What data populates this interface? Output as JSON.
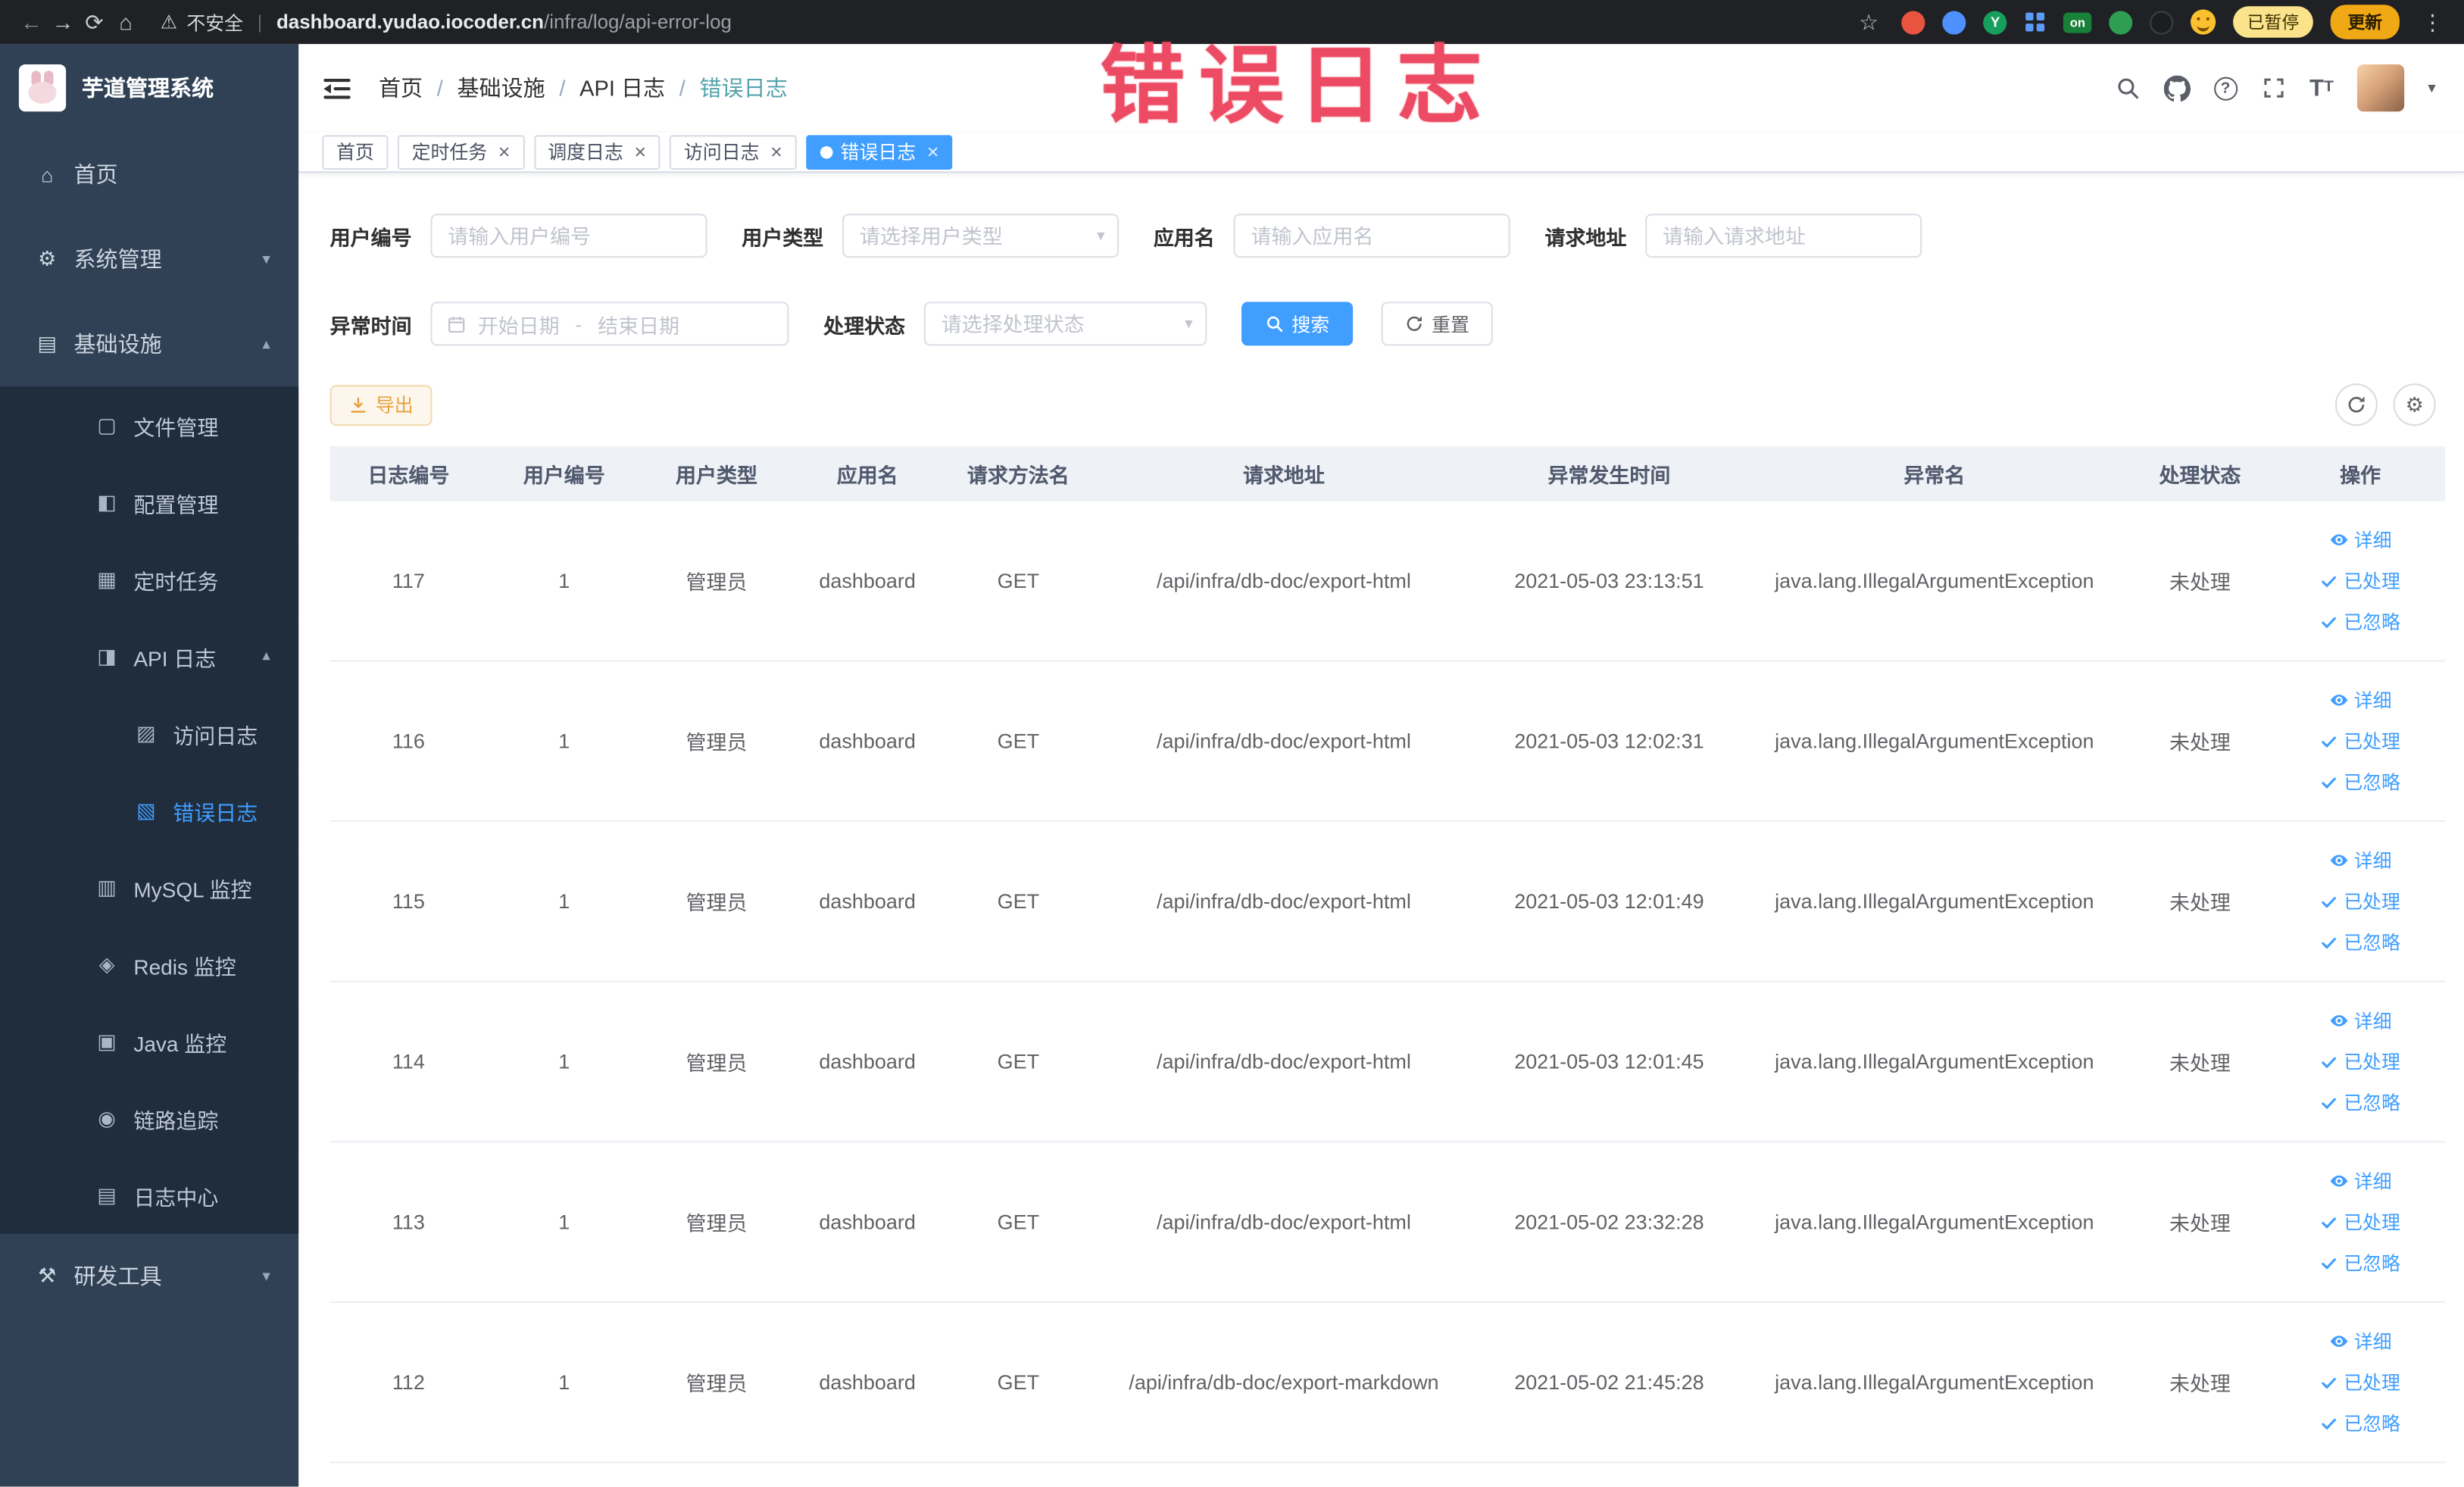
{
  "browser": {
    "security_label": "不安全",
    "url_host": "dashboard.yudao.iocoder.cn",
    "url_path": "/infra/log/api-error-log",
    "extension_badge_on": "on",
    "extension_letter": "Y",
    "paused_badge": "已暂停",
    "update_button": "更新"
  },
  "annotation": {
    "text": "错误日志",
    "color": "#ec4b63"
  },
  "sidebar": {
    "title": "芋道管理系统",
    "items": [
      {
        "key": "home",
        "label": "首页",
        "icon": "home",
        "level": 1
      },
      {
        "key": "system-mgmt",
        "label": "系统管理",
        "icon": "system",
        "level": 1,
        "arrow": "down"
      },
      {
        "key": "infrastructure",
        "label": "基础设施",
        "icon": "infra",
        "level": 1,
        "arrow": "up"
      },
      {
        "key": "file-mgmt",
        "label": "文件管理",
        "icon": "file",
        "level": 2,
        "sub": true
      },
      {
        "key": "config-mgmt",
        "label": "配置管理",
        "icon": "config",
        "level": 2,
        "sub": true
      },
      {
        "key": "scheduled-tasks",
        "label": "定时任务",
        "icon": "task",
        "level": 2,
        "sub": true
      },
      {
        "key": "api-log",
        "label": "API 日志",
        "icon": "apilog",
        "level": 2,
        "sub": true,
        "arrow": "up"
      },
      {
        "key": "access-log",
        "label": "访问日志",
        "icon": "access",
        "level": 3,
        "sub": true
      },
      {
        "key": "error-log",
        "label": "错误日志",
        "icon": "error",
        "level": 3,
        "sub": true,
        "active": true
      },
      {
        "key": "mysql-monitor",
        "label": "MySQL 监控",
        "icon": "mysql",
        "level": 2,
        "sub": true
      },
      {
        "key": "redis-monitor",
        "label": "Redis 监控",
        "icon": "redis",
        "level": 2,
        "sub": true
      },
      {
        "key": "java-monitor",
        "label": "Java 监控",
        "icon": "java",
        "level": 2,
        "sub": true
      },
      {
        "key": "trace",
        "label": "链路追踪",
        "icon": "trace",
        "level": 2,
        "sub": true
      },
      {
        "key": "log-center",
        "label": "日志中心",
        "icon": "logcenter",
        "level": 2,
        "sub": true
      },
      {
        "key": "dev-tools",
        "label": "研发工具",
        "icon": "tools",
        "level": 1,
        "arrow": "down"
      }
    ]
  },
  "breadcrumb": [
    "首页",
    "基础设施",
    "API 日志",
    "错误日志"
  ],
  "tabs": [
    {
      "label": "首页",
      "closable": false,
      "active": false
    },
    {
      "label": "定时任务",
      "closable": true,
      "active": false
    },
    {
      "label": "调度日志",
      "closable": true,
      "active": false
    },
    {
      "label": "访问日志",
      "closable": true,
      "active": false
    },
    {
      "label": "错误日志",
      "closable": true,
      "active": true
    }
  ],
  "filters": {
    "fields_row1": [
      {
        "label": "用户编号",
        "type": "input",
        "placeholder": "请输入用户编号"
      },
      {
        "label": "用户类型",
        "type": "select",
        "placeholder": "请选择用户类型"
      },
      {
        "label": "应用名",
        "type": "input",
        "placeholder": "请输入应用名"
      },
      {
        "label": "请求地址",
        "type": "input",
        "placeholder": "请输入请求地址"
      }
    ],
    "date_field": {
      "label": "异常时间",
      "start_placeholder": "开始日期",
      "separator": "-",
      "end_placeholder": "结束日期"
    },
    "status_field": {
      "label": "处理状态",
      "placeholder": "请选择处理状态"
    },
    "search_button": "搜索",
    "reset_button": "重置"
  },
  "toolbar": {
    "export_button": "导出"
  },
  "table": {
    "columns": [
      "日志编号",
      "用户编号",
      "用户类型",
      "应用名",
      "请求方法名",
      "请求地址",
      "异常发生时间",
      "异常名",
      "处理状态",
      "操作"
    ],
    "action_labels": [
      "详细",
      "已处理",
      "已忽略"
    ],
    "rows": [
      {
        "log_id": "117",
        "user_id": "1",
        "user_type": "管理员",
        "app": "dashboard",
        "method": "GET",
        "url": "/api/infra/db-doc/export-html",
        "time": "2021-05-03 23:13:51",
        "exception": "java.lang.IllegalArgumentException",
        "status": "未处理"
      },
      {
        "log_id": "116",
        "user_id": "1",
        "user_type": "管理员",
        "app": "dashboard",
        "method": "GET",
        "url": "/api/infra/db-doc/export-html",
        "time": "2021-05-03 12:02:31",
        "exception": "java.lang.IllegalArgumentException",
        "status": "未处理"
      },
      {
        "log_id": "115",
        "user_id": "1",
        "user_type": "管理员",
        "app": "dashboard",
        "method": "GET",
        "url": "/api/infra/db-doc/export-html",
        "time": "2021-05-03 12:01:49",
        "exception": "java.lang.IllegalArgumentException",
        "status": "未处理"
      },
      {
        "log_id": "114",
        "user_id": "1",
        "user_type": "管理员",
        "app": "dashboard",
        "method": "GET",
        "url": "/api/infra/db-doc/export-html",
        "time": "2021-05-03 12:01:45",
        "exception": "java.lang.IllegalArgumentException",
        "status": "未处理"
      },
      {
        "log_id": "113",
        "user_id": "1",
        "user_type": "管理员",
        "app": "dashboard",
        "method": "GET",
        "url": "/api/infra/db-doc/export-html",
        "time": "2021-05-02 23:32:28",
        "exception": "java.lang.IllegalArgumentException",
        "status": "未处理"
      },
      {
        "log_id": "112",
        "user_id": "1",
        "user_type": "管理员",
        "app": "dashboard",
        "method": "GET",
        "url": "/api/infra/db-doc/export-markdown",
        "time": "2021-05-02 21:45:28",
        "exception": "java.lang.IllegalArgumentException",
        "status": "未处理"
      }
    ]
  },
  "colors": {
    "accent": "#409eff",
    "warning": "#e6a23c",
    "sidebar_bg": "#304156",
    "submenu_bg": "#1f2d3d",
    "chrome_bg": "#202124"
  }
}
